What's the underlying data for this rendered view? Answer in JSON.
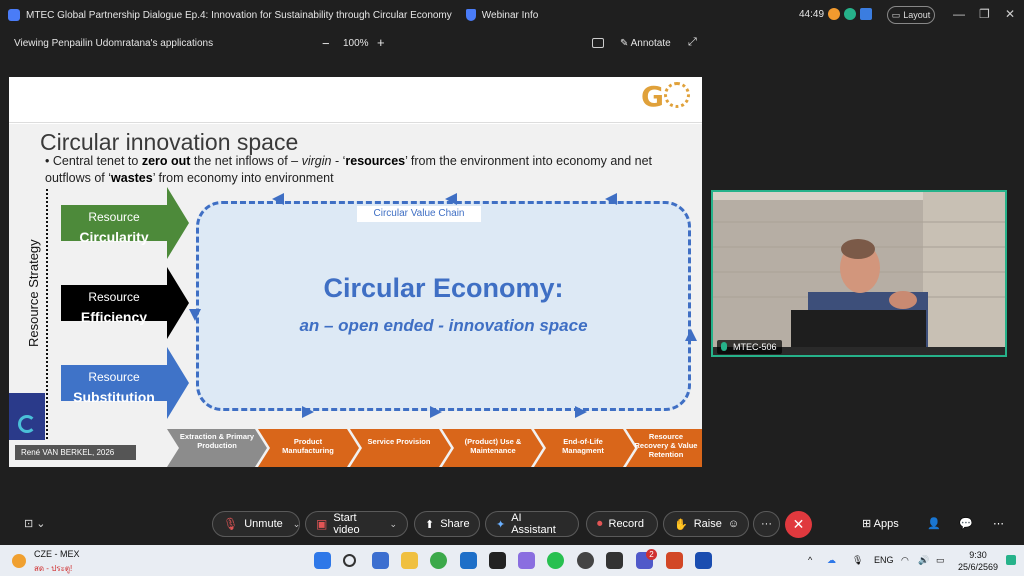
{
  "titlebar": {
    "title": "MTEC Global Partnership Dialogue Ep.4: Innovation for Sustainability through Circular Economy",
    "webinar_info": "Webinar Info",
    "timer": "44:49",
    "layout_label": "Layout"
  },
  "sharebar": {
    "viewing": "Viewing Penpailin Udomratana's applications",
    "zoom": "100%",
    "annotate": "Annotate"
  },
  "slide": {
    "heading": "Circular innovation space",
    "bullet_p1": "Central tenet to ",
    "bullet_b1": "zero out",
    "bullet_p2": " the net inflows of – ",
    "bullet_i1": "virgin",
    "bullet_p3": " - ‘",
    "bullet_b2": "resources",
    "bullet_p4": "’ from the  environment into economy and net outflows of ‘",
    "bullet_b3": "wastes",
    "bullet_p5": "’ from economy into environment",
    "resource_strategy": "Resource Strategy",
    "arrows": [
      {
        "line1": "Resource",
        "line2": "Circularity",
        "color": "#4d8a3a"
      },
      {
        "line1": "Resource",
        "line2": "Efficiency",
        "color": "#000000"
      },
      {
        "line1": "Resource",
        "line2": "Substitution",
        "color": "#3f73c8"
      }
    ],
    "chain_label": "Circular Value Chain",
    "ce_title": "Circular Economy:",
    "ce_subtitle": "an – open ended - innovation space",
    "credit": "René VAN BERKEL, 2026",
    "stages": [
      {
        "text": "Extraction & Primary Production",
        "color": "#8c8c8c"
      },
      {
        "text": "Product Manufacturing",
        "color": "#d9661a"
      },
      {
        "text": "Service Provision",
        "color": "#d9661a"
      },
      {
        "text": "(Product) Use & Maintenance",
        "color": "#d9661a"
      },
      {
        "text": "End-of-Life Managment",
        "color": "#d9661a"
      },
      {
        "text": "Resource Recovery & Value Retention",
        "color": "#d9661a"
      }
    ],
    "accent": "#3f6fc4"
  },
  "camera": {
    "participant": "MTEC-506"
  },
  "toolbar": {
    "unmute": "Unmute",
    "start_video": "Start video",
    "share": "Share",
    "ai_assistant": "AI Assistant",
    "record": "Record",
    "raise": "Raise",
    "more": "···",
    "apps": "Apps"
  },
  "taskbar": {
    "weather_line1": "CZE - MEX",
    "weather_line2": "สด - ประตู!",
    "lang": "ENG",
    "time": "9:30",
    "date": "25/6/2569",
    "badge": "2"
  }
}
